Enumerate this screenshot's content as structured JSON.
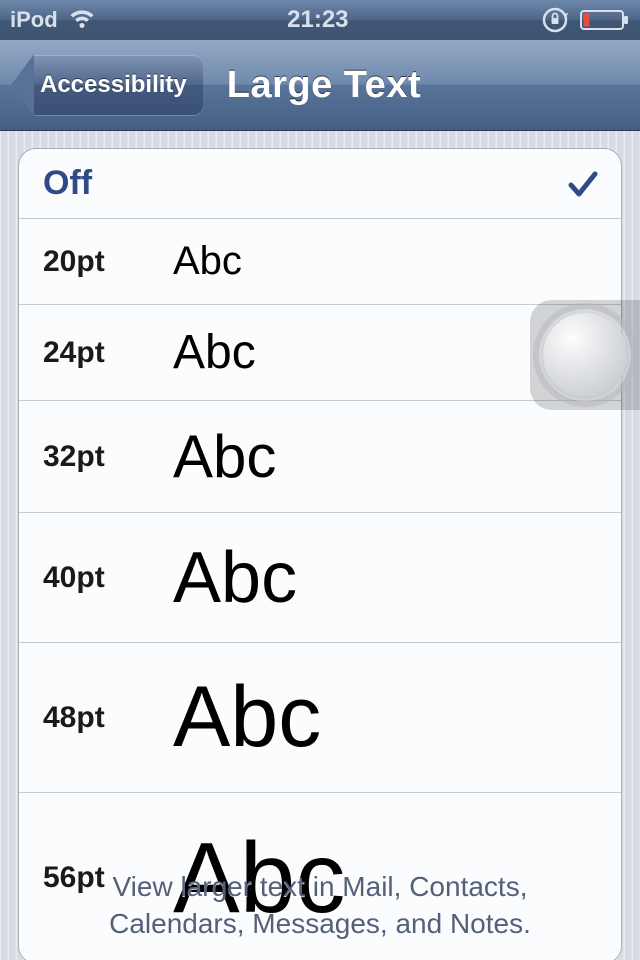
{
  "status": {
    "device": "iPod",
    "time": "21:23"
  },
  "nav": {
    "back": "Accessibility",
    "title": "Large Text"
  },
  "list": {
    "off": "Off",
    "sample": "Abc",
    "rows": [
      {
        "label": "20pt"
      },
      {
        "label": "24pt"
      },
      {
        "label": "32pt"
      },
      {
        "label": "40pt"
      },
      {
        "label": "48pt"
      },
      {
        "label": "56pt"
      }
    ]
  },
  "footer": {
    "line1": "View larger text in Mail, Contacts,",
    "line2": "Calendars, Messages, and Notes."
  }
}
